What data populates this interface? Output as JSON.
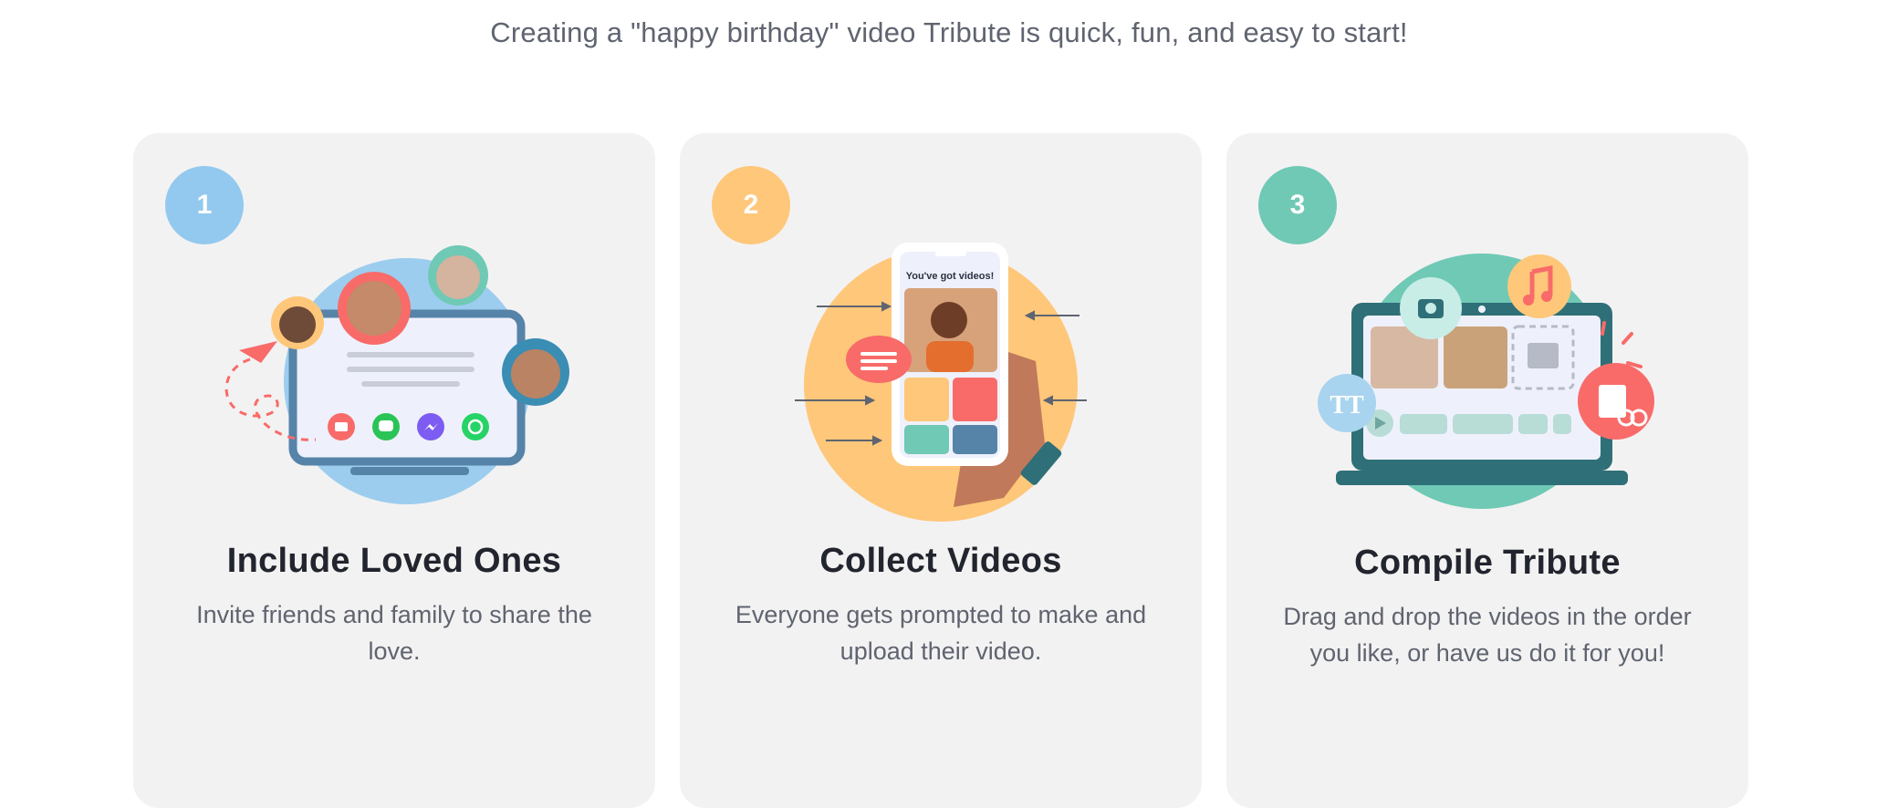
{
  "intro": "Creating a \"happy birthday\" video Tribute is quick, fun, and easy to start!",
  "steps": [
    {
      "number": "1",
      "badge_color": "#93c9ee",
      "title": "Include Loved Ones",
      "description": "Invite friends and family to share the love.",
      "icons": [
        "paper-plane-icon",
        "email-icon",
        "message-icon",
        "messenger-icon",
        "whatsapp-icon"
      ]
    },
    {
      "number": "2",
      "badge_color": "#fec77a",
      "title": "Collect Videos",
      "description": "Everyone gets prompted to make and upload their video.",
      "phone_text": "You've got videos!",
      "icons": [
        "chat-bubble-icon",
        "phone-icon"
      ]
    },
    {
      "number": "3",
      "badge_color": "#6fc9b5",
      "title": "Compile Tribute",
      "description": "Drag and drop the videos in the order you like, or have us do it for you!",
      "icons": [
        "camera-icon",
        "music-note-icon",
        "text-icon",
        "scissors-icon",
        "play-icon",
        "image-icon"
      ]
    }
  ],
  "colors": {
    "card_bg": "#f3f2f2",
    "coral": "#f86b69",
    "teal": "#2f6f78",
    "blue_screen": "#5683a8"
  }
}
